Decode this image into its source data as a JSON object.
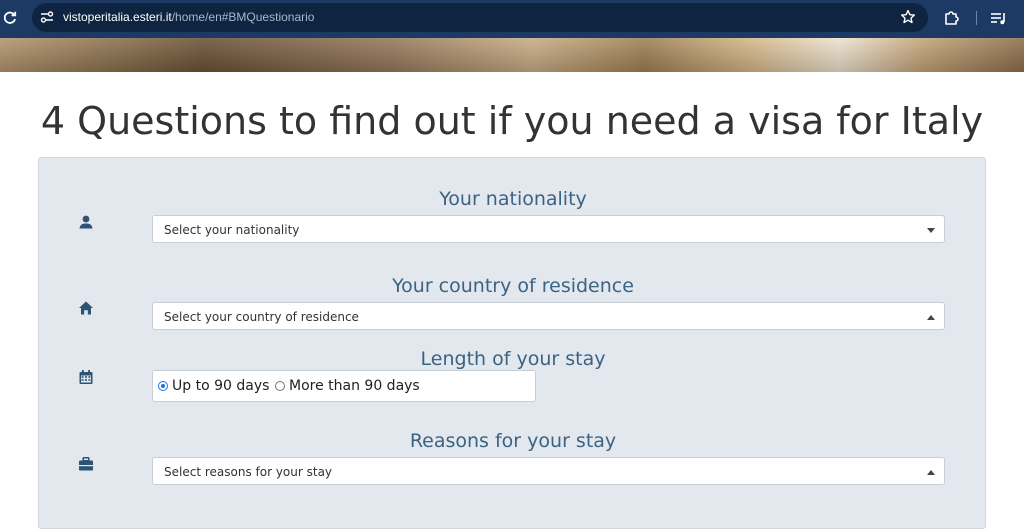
{
  "browser": {
    "url_host": "vistoperitalia.esteri.it",
    "url_path": "/home/en#BMQuestionario"
  },
  "page": {
    "title": "4 Questions to find out if you need a visa for Italy"
  },
  "questions": {
    "nationality": {
      "label": "Your nationality",
      "placeholder": "Select your nationality",
      "icon": "user-icon"
    },
    "residence": {
      "label": "Your country of residence",
      "placeholder": "Select your country of residence",
      "icon": "home-icon"
    },
    "stay_length": {
      "label": "Length of your stay",
      "icon": "calendar-icon",
      "options": [
        {
          "label": "Up to 90 days",
          "checked": true
        },
        {
          "label": "More than 90 days",
          "checked": false
        }
      ]
    },
    "reasons": {
      "label": "Reasons for your stay",
      "placeholder": "Select reasons for your stay",
      "icon": "briefcase-icon"
    }
  },
  "colors": {
    "browser_bar": "#1c3a63",
    "panel_bg": "#e3e7ee",
    "label_color": "#3b6382",
    "icon_color": "#2f5373"
  }
}
